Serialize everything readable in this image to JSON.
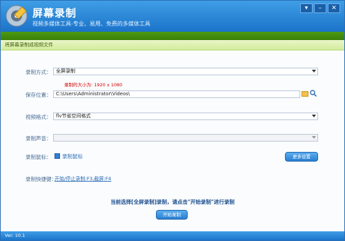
{
  "app": {
    "title": "屏幕录制",
    "subtitle": "视频多媒体工具-专业、易用、免费的多媒体工具"
  },
  "window_buttons": {
    "menu": "▾",
    "minimize": "–",
    "close": "✕"
  },
  "section": {
    "title": "将屏幕录制成视频文件"
  },
  "form": {
    "mode_label": "录制方式：",
    "mode_value": "全屏录制",
    "size_hint": "录制的大小为: 1920 x 1080",
    "save_label": "保存位置：",
    "save_value": "C:\\Users\\Administrator\\Videos\\",
    "format_label": "视频格式：",
    "format_value": "flv节省空间格式",
    "audio_label": "录制声音：",
    "audio_value": "",
    "mouse_label": "录制鼠标：",
    "mouse_checkbox_label": "录制鼠标",
    "mouse_checked": true,
    "more_settings": "更多设置",
    "hotkey_label": "录制快捷键：",
    "hotkey_value": "开始/停止录制:F3,截屏:F4"
  },
  "status": {
    "message": "当前选择[全屏录制]录制，请点击\"开始录制\"进行录制"
  },
  "actions": {
    "start": "开始录制"
  },
  "footer": {
    "version": "Ver: 10.1"
  },
  "icons": [
    "app-logo-icon",
    "folder-icon",
    "search-icon",
    "dropdown-arrow-icon"
  ]
}
